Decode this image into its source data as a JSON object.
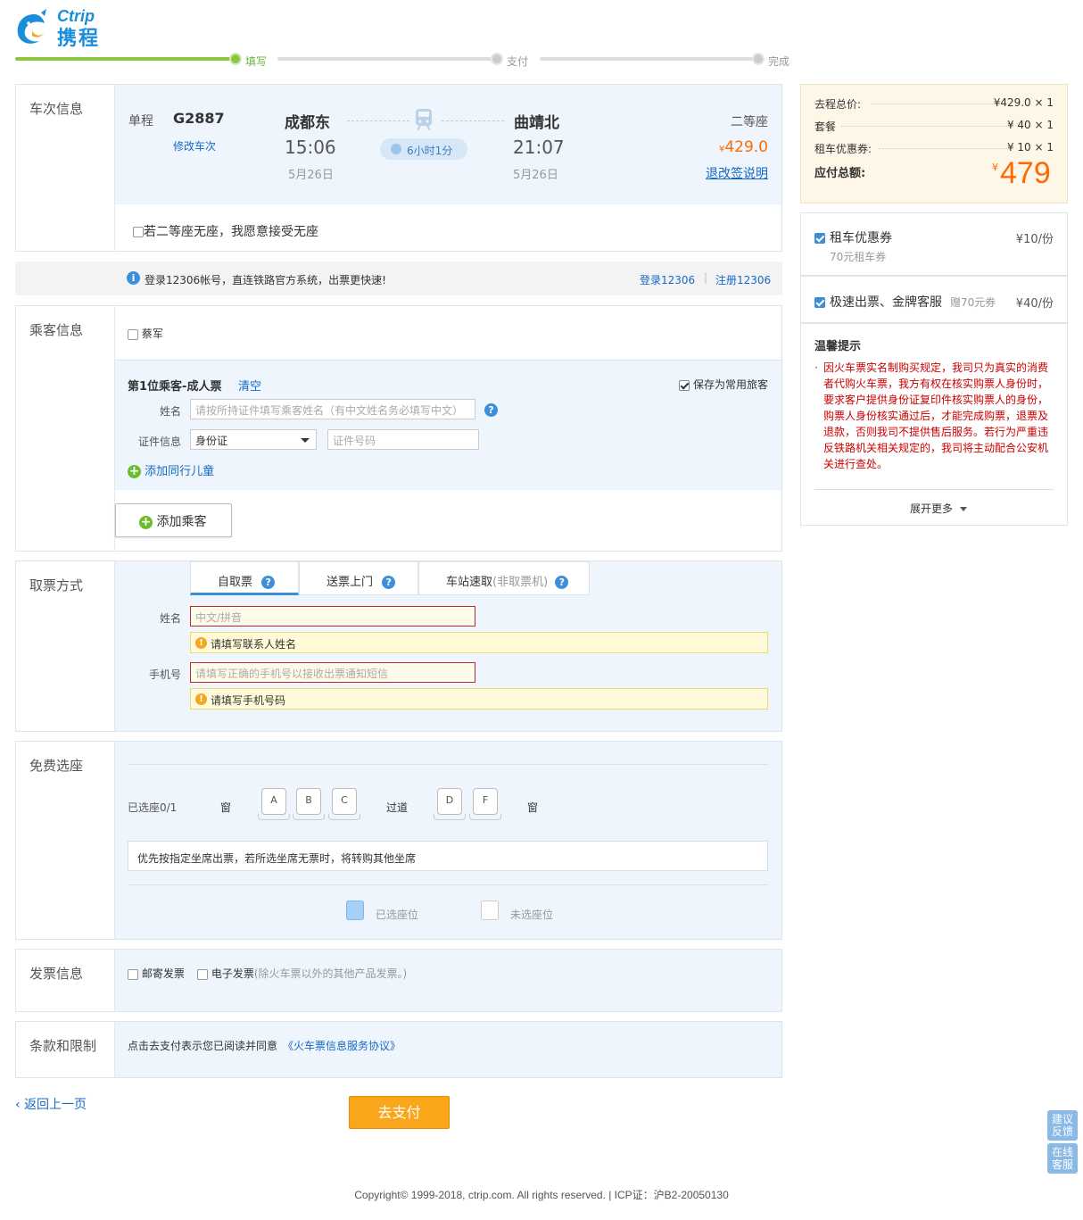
{
  "brand": {
    "en": "Ctrip",
    "cn": "携程"
  },
  "steps": [
    {
      "label": "填写"
    },
    {
      "label": "支付"
    },
    {
      "label": "完成"
    }
  ],
  "train": {
    "section_title": "车次信息",
    "trip_type": "单程",
    "number": "G2887",
    "change_link": "修改车次",
    "from_station": "成都东",
    "depart_time": "15:06",
    "depart_date": "5月26日",
    "duration": "6小时1分",
    "to_station": "曲靖北",
    "arrive_time": "21:07",
    "arrive_date": "5月26日",
    "seat_class": "二等座",
    "price_symbol": "¥",
    "price": "429.0",
    "refund_link": "退改签说明",
    "no_seat_option": "若二等座无座，我愿意接受无座"
  },
  "login_bar": {
    "text": "登录12306帐号，直连铁路官方系统，出票更快速!",
    "login_link": "登录12306",
    "sep": "|",
    "register_link": "注册12306"
  },
  "passenger": {
    "section_title": "乘客信息",
    "saved_name": "蔡军",
    "card_title": "第1位乘客-成人票",
    "clear_link": "清空",
    "save_frequent": "保存为常用旅客",
    "name_label": "姓名",
    "name_placeholder": "请按所持证件填写乘客姓名（有中文姓名务必填写中文）",
    "id_label": "证件信息",
    "id_type": "身份证",
    "id_placeholder": "证件号码",
    "add_child": "添加同行儿童",
    "add_passenger": "添加乘客"
  },
  "pickup": {
    "section_title": "取票方式",
    "tabs": [
      {
        "label": "自取票"
      },
      {
        "label": "送票上门"
      },
      {
        "label": "车站速取",
        "note": "(非取票机)"
      }
    ],
    "name_label": "姓名",
    "name_placeholder": "中文/拼音",
    "name_warning": "请填写联系人姓名",
    "phone_label": "手机号",
    "phone_placeholder": "请填写正确的手机号以接收出票通知短信",
    "phone_warning": "请填写手机号码"
  },
  "seat_select": {
    "section_title": "免费选座",
    "selected_count": "已选座0/1",
    "window_left": "窗",
    "seats_left": [
      "A",
      "B",
      "C"
    ],
    "aisle": "过道",
    "seats_right": [
      "D",
      "F"
    ],
    "window_right": "窗",
    "notice": "优先按指定坐席出票，若所选坐席无票时，将转购其他坐席",
    "legend_selected": "已选座位",
    "legend_unselected": "未选座位"
  },
  "invoice": {
    "section_title": "发票信息",
    "mail": "邮寄发票",
    "electronic": "电子发票",
    "electronic_note": "(除火车票以外的其他产品发票。)"
  },
  "terms": {
    "section_title": "条款和限制",
    "text": "点击去支付表示您已阅读并同意",
    "link": "《火车票信息服务协议》"
  },
  "actions": {
    "back": "返回上一页",
    "pay": "去支付"
  },
  "footer": "Copyright© 1999-2018, ctrip.com. All rights reserved. | ICP证：沪B2-20050130",
  "summary": {
    "rows": [
      {
        "label": "去程总价:",
        "value": "¥429.0 × 1"
      },
      {
        "label": "套餐",
        "value": "¥ 40 × 1"
      },
      {
        "label": "租车优惠券:",
        "value": "¥ 10 × 1"
      }
    ],
    "total_label": "应付总额:",
    "total_symbol": "¥",
    "total": "479"
  },
  "addons": [
    {
      "title": "租车优惠券",
      "sub": "70元租车券",
      "price": "¥10/份"
    },
    {
      "title": "极速出票、金牌客服",
      "sub": "赠70元券",
      "price": "¥40/份"
    }
  ],
  "tips": {
    "title": "温馨提示",
    "lines": [
      "因火车票实名制购买规定，我司只为真实的消费",
      "者代购火车票，我方有权在核实购票人身份时，",
      "要求客户提供身份证复印件核实购票人的身份，",
      "购票人身份核实通过后，才能完成购票，退票及",
      "退款，否则我司不提供售后服务。若行为严重违",
      "反铁路机关相关规定的，我司将主动配合公安机",
      "关进行查处。"
    ],
    "more": "展开更多"
  },
  "floating": {
    "feedback": "建议反馈",
    "service": "在线客服"
  },
  "colors": {
    "accent": "#1769c9",
    "price": "#ff6a00",
    "progress": "#8cc63f",
    "pay_button": "#f9a61a"
  }
}
